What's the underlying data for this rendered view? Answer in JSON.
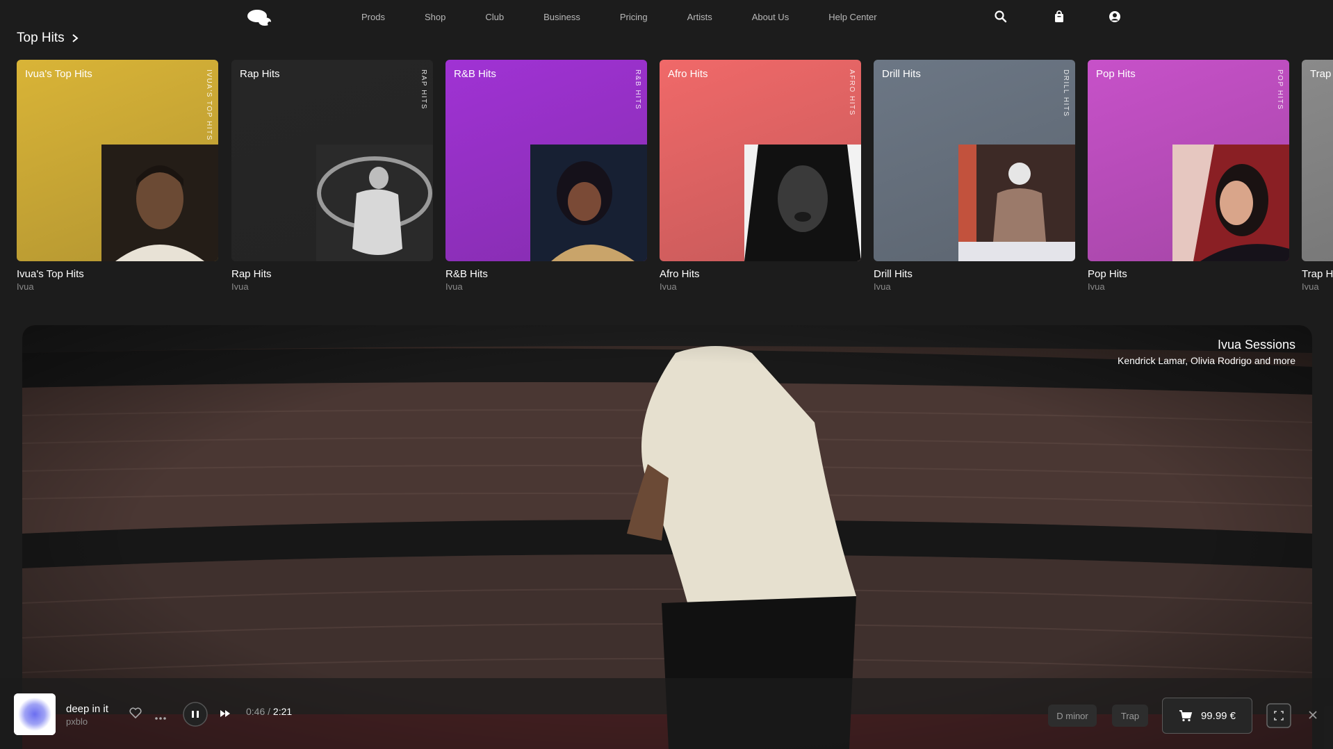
{
  "nav": {
    "links": [
      "Prods",
      "Shop",
      "Club",
      "Business",
      "Pricing",
      "Artists",
      "About Us",
      "Help Center"
    ],
    "icons": [
      "search-icon",
      "bag-icon",
      "account-icon"
    ]
  },
  "section": {
    "title": "Top Hits"
  },
  "cards": [
    {
      "cover_title": "Ivua's Top Hits",
      "vertical": "IVUA'S TOP HITS",
      "title": "Ivua's Top Hits",
      "sub": "Ivua",
      "color": "#d9b437"
    },
    {
      "cover_title": "Rap Hits",
      "vertical": "RAP HITS",
      "title": "Rap Hits",
      "sub": "Ivua",
      "color": "#262626"
    },
    {
      "cover_title": "R&B Hits",
      "vertical": "R&B HITS",
      "title": "R&B Hits",
      "sub": "Ivua",
      "color": "#a032d4"
    },
    {
      "cover_title": "Afro Hits",
      "vertical": "AFRO HITS",
      "title": "Afro Hits",
      "sub": "Ivua",
      "color": "#f06969"
    },
    {
      "cover_title": "Drill Hits",
      "vertical": "DRILL HITS",
      "title": "Drill Hits",
      "sub": "Ivua",
      "color": "#6c7785"
    },
    {
      "cover_title": "Pop Hits",
      "vertical": "POP HITS",
      "title": "Pop Hits",
      "sub": "Ivua",
      "color": "#c751c9"
    },
    {
      "cover_title": "Trap",
      "vertical": "",
      "title": "Trap Hi",
      "sub": "Ivua",
      "color": "#8a8a8a"
    }
  ],
  "video": {
    "title": "Ivua Sessions",
    "subtitle": "Kendrick Lamar, Olivia Rodrigo and more"
  },
  "player": {
    "track": "deep in it",
    "artist": "pxblo",
    "elapsed": "0:46",
    "separator": "/",
    "total": "2:21",
    "key": "D minor",
    "genre": "Trap",
    "price": "99.99 €"
  }
}
